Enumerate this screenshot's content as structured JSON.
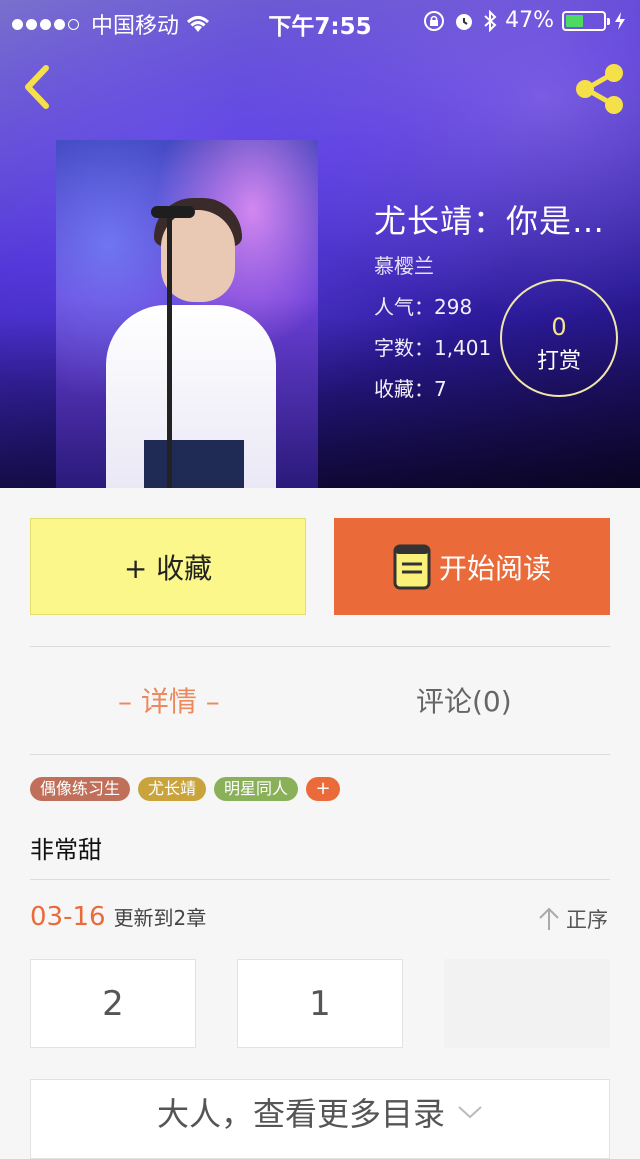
{
  "status_bar": {
    "carrier": "中国移动",
    "time": "下午7:55",
    "battery": "47%",
    "battery_level": 0.47
  },
  "nav": {
    "back_icon": "chevron-left-icon",
    "share_icon": "share-icon",
    "accent_color": "#f5e04a"
  },
  "book": {
    "title": "尤长靖：你是…",
    "author": "慕樱兰",
    "popularity_label": "人气：298",
    "word_count_label": "字数：1,401",
    "favorites_label": "收藏：7"
  },
  "reward": {
    "count": "0",
    "label": "打赏"
  },
  "actions": {
    "favorite_label": "+ 收藏",
    "read_label": "开始阅读",
    "favorite_color": "#fbf78a",
    "read_color": "#ea6a3a"
  },
  "tabs": {
    "detail": "– 详情 –",
    "comments": "评论(0)"
  },
  "tags": [
    {
      "label": "偶像练习生",
      "color": "#c0705a"
    },
    {
      "label": "尤长靖",
      "color": "#c9a43c"
    },
    {
      "label": "明星同人",
      "color": "#8bb05a"
    }
  ],
  "tag_add": "+",
  "summary": "非常甜",
  "update": {
    "date": "03-16",
    "text": "更新到2章"
  },
  "order_label": "正序",
  "chapters": [
    "2",
    "1"
  ],
  "more_label": "大人，查看更多目录"
}
